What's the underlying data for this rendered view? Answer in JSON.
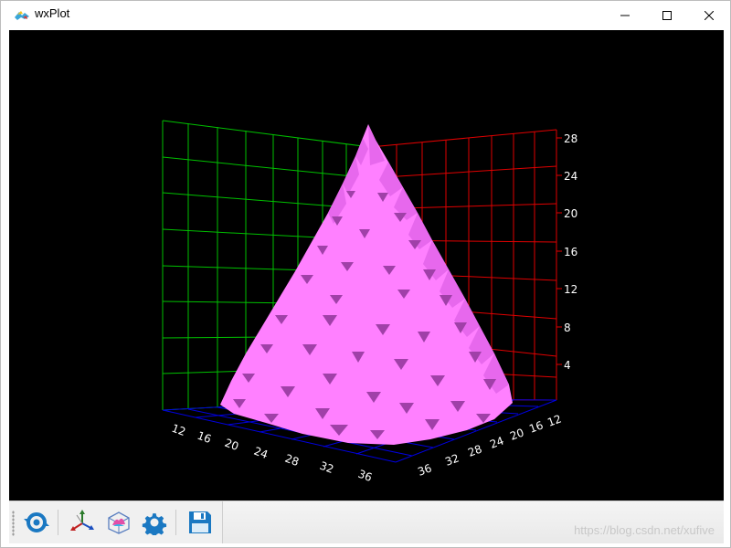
{
  "window": {
    "title": "wxPlot"
  },
  "axes": {
    "x_ticks": [
      "12",
      "16",
      "20",
      "24",
      "28",
      "32",
      "36"
    ],
    "y_ticks": [
      "12",
      "16",
      "20",
      "24",
      "28",
      "32",
      "36"
    ],
    "z_ticks": [
      "4",
      "8",
      "12",
      "16",
      "20",
      "24",
      "28"
    ]
  },
  "toolbar": {
    "buttons": [
      {
        "icon": "reset-view-icon"
      },
      {
        "icon": "axes-icon"
      },
      {
        "icon": "surface-plot-icon"
      },
      {
        "icon": "gear-icon"
      },
      {
        "icon": "save-icon"
      }
    ]
  },
  "watermark": "https://blog.csdn.net/xufive",
  "colors": {
    "surface": "#ff80ff",
    "surface_shadow": "#b040b0",
    "grid_left": "#00c000",
    "grid_right": "#e00000",
    "grid_floor": "#0000e0"
  }
}
